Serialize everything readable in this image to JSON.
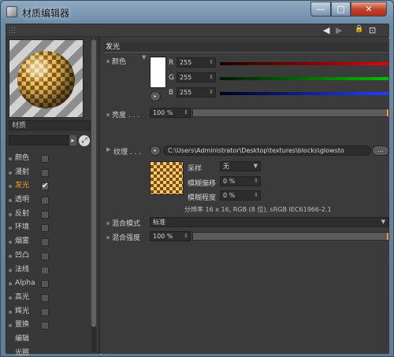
{
  "window": {
    "title": "材质编辑器",
    "minimize": "—",
    "maximize": "□",
    "close": "✕"
  },
  "toolbar": {
    "back": "◀",
    "forward": "▶",
    "lock": "🔒",
    "new": "⊡"
  },
  "material": {
    "name": "材质"
  },
  "channels": [
    {
      "label": "颜色",
      "checked": false
    },
    {
      "label": "漫射",
      "checked": false
    },
    {
      "label": "发光",
      "checked": true,
      "active": true
    },
    {
      "label": "透明",
      "checked": false
    },
    {
      "label": "反射",
      "checked": false
    },
    {
      "label": "环境",
      "checked": false
    },
    {
      "label": "烟雾",
      "checked": false
    },
    {
      "label": "凹凸",
      "checked": false
    },
    {
      "label": "法线",
      "checked": false
    },
    {
      "label": "Alpha",
      "checked": false
    },
    {
      "label": "高光",
      "checked": false
    },
    {
      "label": "辉光",
      "checked": false
    },
    {
      "label": "置换",
      "checked": false
    },
    {
      "label": "编辑"
    },
    {
      "label": "光照"
    }
  ],
  "panel": {
    "section": "发光",
    "color": {
      "label": "颜色",
      "r_label": "R",
      "g_label": "G",
      "b_label": "B",
      "r": "255",
      "g": "255",
      "b": "255",
      "swatch": "#ffffff"
    },
    "brightness": {
      "label": "亮度 . . .",
      "value": "100 %"
    },
    "texture": {
      "label": "纹理 . . .",
      "path": "C:\\Users\\Administrator\\Desktop\\textures\\blocks\\glowsto",
      "more": "...",
      "sampling_label": "采样",
      "sampling_value": "无",
      "blur_offset_label": "模糊偏移",
      "blur_offset_value": "0 %",
      "blur_scale_label": "模糊程度",
      "blur_scale_value": "0 %",
      "info": "分辨率 16 x 16, RGB (8 位), sRGB IEC61966-2.1"
    },
    "blend_mode": {
      "label": "混合模式",
      "value": "标准"
    },
    "blend_strength": {
      "label": "混合强度",
      "value": "100 %"
    }
  },
  "colors": {
    "accent": "#ff9a2e",
    "red": "#d62020",
    "green": "#20b020",
    "blue": "#1f3fd4"
  }
}
